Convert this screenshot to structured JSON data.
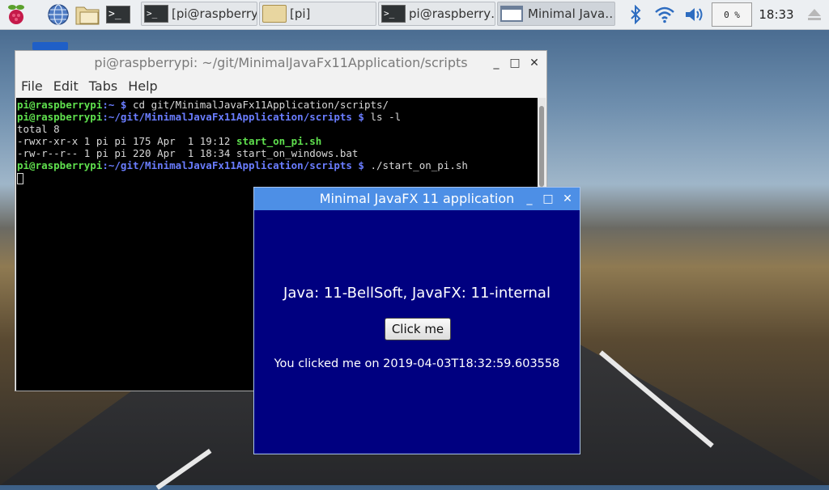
{
  "taskbar": {
    "tasks": [
      {
        "label": "[pi@raspberry…"
      },
      {
        "label": "[pi]"
      },
      {
        "label": "pi@raspberry…"
      },
      {
        "label": "Minimal Java…"
      }
    ],
    "cpu_label": "0 %",
    "clock": "18:33",
    "icons": [
      "raspberry-menu-icon",
      "web-browser-icon",
      "file-manager-icon",
      "terminal-icon",
      "bluetooth-icon",
      "wifi-icon",
      "volume-icon",
      "eject-icon"
    ]
  },
  "terminal": {
    "title": "pi@raspberrypi: ~/git/MinimalJavaFx11Application/scripts",
    "menu": [
      "File",
      "Edit",
      "Tabs",
      "Help"
    ],
    "lines": {
      "l1_user": "pi@raspberrypi",
      "l1_path": ":~ $",
      "l1_cmd": " cd git/MinimalJavaFx11Application/scripts/",
      "l2_user": "pi@raspberrypi",
      "l2_path": ":~/git/MinimalJavaFx11Application/scripts $",
      "l2_cmd": " ls -l",
      "l3": "total 8",
      "l4_meta": "-rwxr-xr-x 1 pi pi 175 Apr  1 19:12 ",
      "l4_file": "start_on_pi.sh",
      "l5": "-rw-r--r-- 1 pi pi 220 Apr  1 18:34 start_on_windows.bat",
      "l6_user": "pi@raspberrypi",
      "l6_path": ":~/git/MinimalJavaFx11Application/scripts $",
      "l6_cmd": " ./start_on_pi.sh"
    }
  },
  "fx_window": {
    "title": "Minimal JavaFX 11 application",
    "java_info": "Java: 11-BellSoft, JavaFX: 11-internal",
    "button_label": "Click me",
    "clicked_text": "You clicked me on 2019-04-03T18:32:59.603558"
  },
  "window_controls": {
    "minimize": "_",
    "maximize": "□",
    "close": "✕"
  },
  "colors": {
    "fx_background": "#000080",
    "fx_titlebar": "#4d8fe6",
    "prompt_green": "#5fe04e",
    "prompt_blue": "#6a7dff"
  }
}
